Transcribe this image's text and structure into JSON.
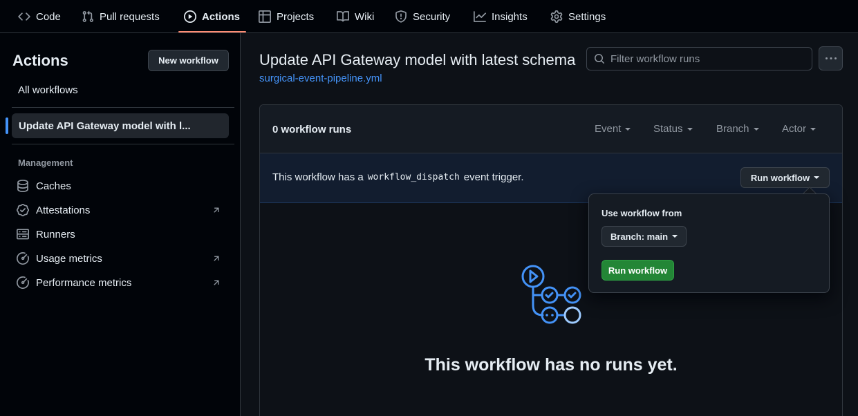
{
  "repo_nav": {
    "tabs": [
      {
        "label": "Code",
        "icon": "code-icon"
      },
      {
        "label": "Pull requests",
        "icon": "git-pull-request-icon"
      },
      {
        "label": "Actions",
        "icon": "play-icon",
        "active": true
      },
      {
        "label": "Projects",
        "icon": "table-icon"
      },
      {
        "label": "Wiki",
        "icon": "book-icon"
      },
      {
        "label": "Security",
        "icon": "shield-icon"
      },
      {
        "label": "Insights",
        "icon": "graph-icon"
      },
      {
        "label": "Settings",
        "icon": "gear-icon"
      }
    ]
  },
  "sidebar": {
    "title": "Actions",
    "new_workflow_label": "New workflow",
    "all_workflows_label": "All workflows",
    "selected_workflow": "Update API Gateway model with l...",
    "management_heading": "Management",
    "management_items": [
      {
        "label": "Caches",
        "icon": "database-icon",
        "external": false
      },
      {
        "label": "Attestations",
        "icon": "verified-icon",
        "external": true
      },
      {
        "label": "Runners",
        "icon": "server-icon",
        "external": false
      },
      {
        "label": "Usage metrics",
        "icon": "meter-icon",
        "external": true
      },
      {
        "label": "Performance metrics",
        "icon": "meter-icon",
        "external": true
      }
    ]
  },
  "main": {
    "title": "Update API Gateway model with latest schema",
    "workflow_file": "surgical-event-pipeline.yml",
    "filter_placeholder": "Filter workflow runs",
    "runs_count": "0 workflow runs",
    "filters": [
      "Event",
      "Status",
      "Branch",
      "Actor"
    ],
    "dispatch": {
      "text_before": "This workflow has a",
      "code": "workflow_dispatch",
      "text_after": "event trigger.",
      "run_button": "Run workflow"
    },
    "popover": {
      "title": "Use workflow from",
      "branch_button": "Branch: main",
      "run_button": "Run workflow"
    },
    "empty_state": "This workflow has no runs yet."
  },
  "colors": {
    "background": "#0d1117",
    "accent_link": "#4493f8",
    "tab_underline": "#fd8c73",
    "run_button_green": "#238636"
  }
}
